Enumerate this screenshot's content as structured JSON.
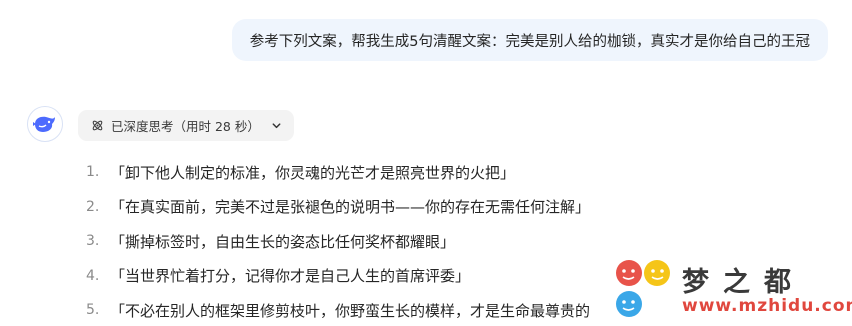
{
  "user_message": {
    "text": "参考下列文案，帮我生成5句清醒文案：完美是别人给的枷锁，真实才是你给自己的王冠"
  },
  "assistant": {
    "avatar_icon": "whale-icon",
    "thinking_chip": {
      "icon": "atom-icon",
      "label": "已深度思考（用时 28 秒）",
      "chevron_icon": "chevron-down-icon"
    },
    "items": [
      {
        "num": "1.",
        "text": "「卸下他人制定的标准，你灵魂的光芒才是照亮世界的火把」"
      },
      {
        "num": "2.",
        "text": "「在真实面前，完美不过是张褪色的说明书——你的存在无需任何注解」"
      },
      {
        "num": "3.",
        "text": "「撕掉标签时，自由生长的姿态比任何奖杯都耀眼」"
      },
      {
        "num": "4.",
        "text": "「当世界忙着打分，记得你才是自己人生的首席评委」"
      },
      {
        "num": "5.",
        "text": "「不必在别人的框架里修剪枝叶，你野蛮生长的模样，才是生命最尊贵的"
      }
    ]
  },
  "watermark": {
    "name": "梦之都",
    "url": "www.mzhidu.com"
  },
  "colors": {
    "user_bubble_bg": "#eff5fd",
    "chip_bg": "#f3f3f3",
    "brand_blue": "#4d6bfe",
    "watermark_red": "#e0473e"
  }
}
